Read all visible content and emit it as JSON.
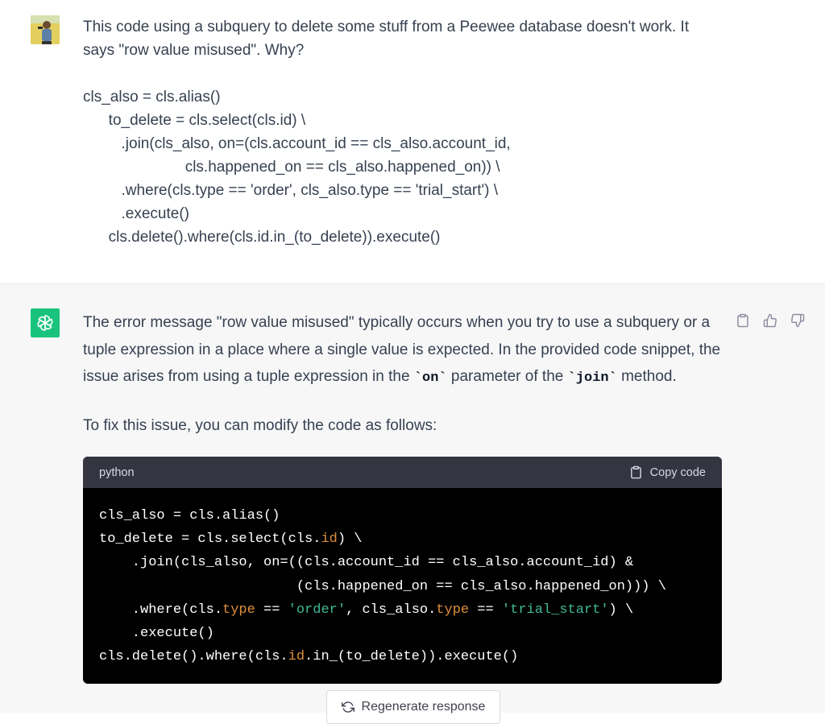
{
  "user_message": {
    "text_line1": "This code using a subquery to delete some stuff from a Peewee database doesn't work. It",
    "text_line2": "says \"row value misused\". Why?",
    "code_lines": [
      "cls_also = cls.alias()",
      "      to_delete = cls.select(cls.id) \\",
      "         .join(cls_also, on=(cls.account_id == cls_also.account_id,",
      "                        cls.happened_on == cls_also.happened_on)) \\",
      "         .where(cls.type == 'order', cls_also.type == 'trial_start') \\",
      "         .execute()",
      "      cls.delete().where(cls.id.in_(to_delete)).execute()"
    ]
  },
  "assistant_message": {
    "para1_a": "The error message \"row value misused\" typically occurs when you try to use a subquery or a tuple expression in a place where a single value is expected. In the provided code snippet, the issue arises from using a tuple expression in the ",
    "para1_code1": "`on`",
    "para1_b": " parameter of the ",
    "para1_code2": "`join`",
    "para1_c": " method.",
    "para2": "To fix this issue, you can modify the code as follows:",
    "code_block": {
      "language": "python",
      "copy_label": "Copy code",
      "lines": [
        [
          {
            "t": "cls_also = cls.alias()"
          }
        ],
        [
          {
            "t": "to_delete = cls.select(cls."
          },
          {
            "t": "id",
            "c": "attr"
          },
          {
            "t": ") \\"
          }
        ],
        [
          {
            "t": "    .join(cls_also, on=((cls.account_id == cls_also.account_id) &"
          }
        ],
        [
          {
            "t": "                        (cls.happened_on == cls_also.happened_on))) \\"
          }
        ],
        [
          {
            "t": "    .where(cls."
          },
          {
            "t": "type",
            "c": "attr"
          },
          {
            "t": " == "
          },
          {
            "t": "'order'",
            "c": "str"
          },
          {
            "t": ", cls_also."
          },
          {
            "t": "type",
            "c": "attr"
          },
          {
            "t": " == "
          },
          {
            "t": "'trial_start'",
            "c": "str"
          },
          {
            "t": ") \\"
          }
        ],
        [
          {
            "t": "    .execute()"
          }
        ],
        [
          {
            "t": "cls.delete().where(cls."
          },
          {
            "t": "id",
            "c": "attr"
          },
          {
            "t": ".in_(to_delete)).execute()"
          }
        ]
      ]
    }
  },
  "regenerate_label": "Regenerate response",
  "colors": {
    "assistant_bg": "#f7f7f8",
    "gpt_green": "#19c37d",
    "code_bg": "#000000",
    "code_header_bg": "#343541",
    "attr_orange": "#df8f3b",
    "string_green": "#3fb896"
  },
  "icons": [
    "user-avatar",
    "openai-logo-icon",
    "clipboard-icon",
    "thumbs-up-icon",
    "thumbs-down-icon",
    "refresh-icon"
  ]
}
